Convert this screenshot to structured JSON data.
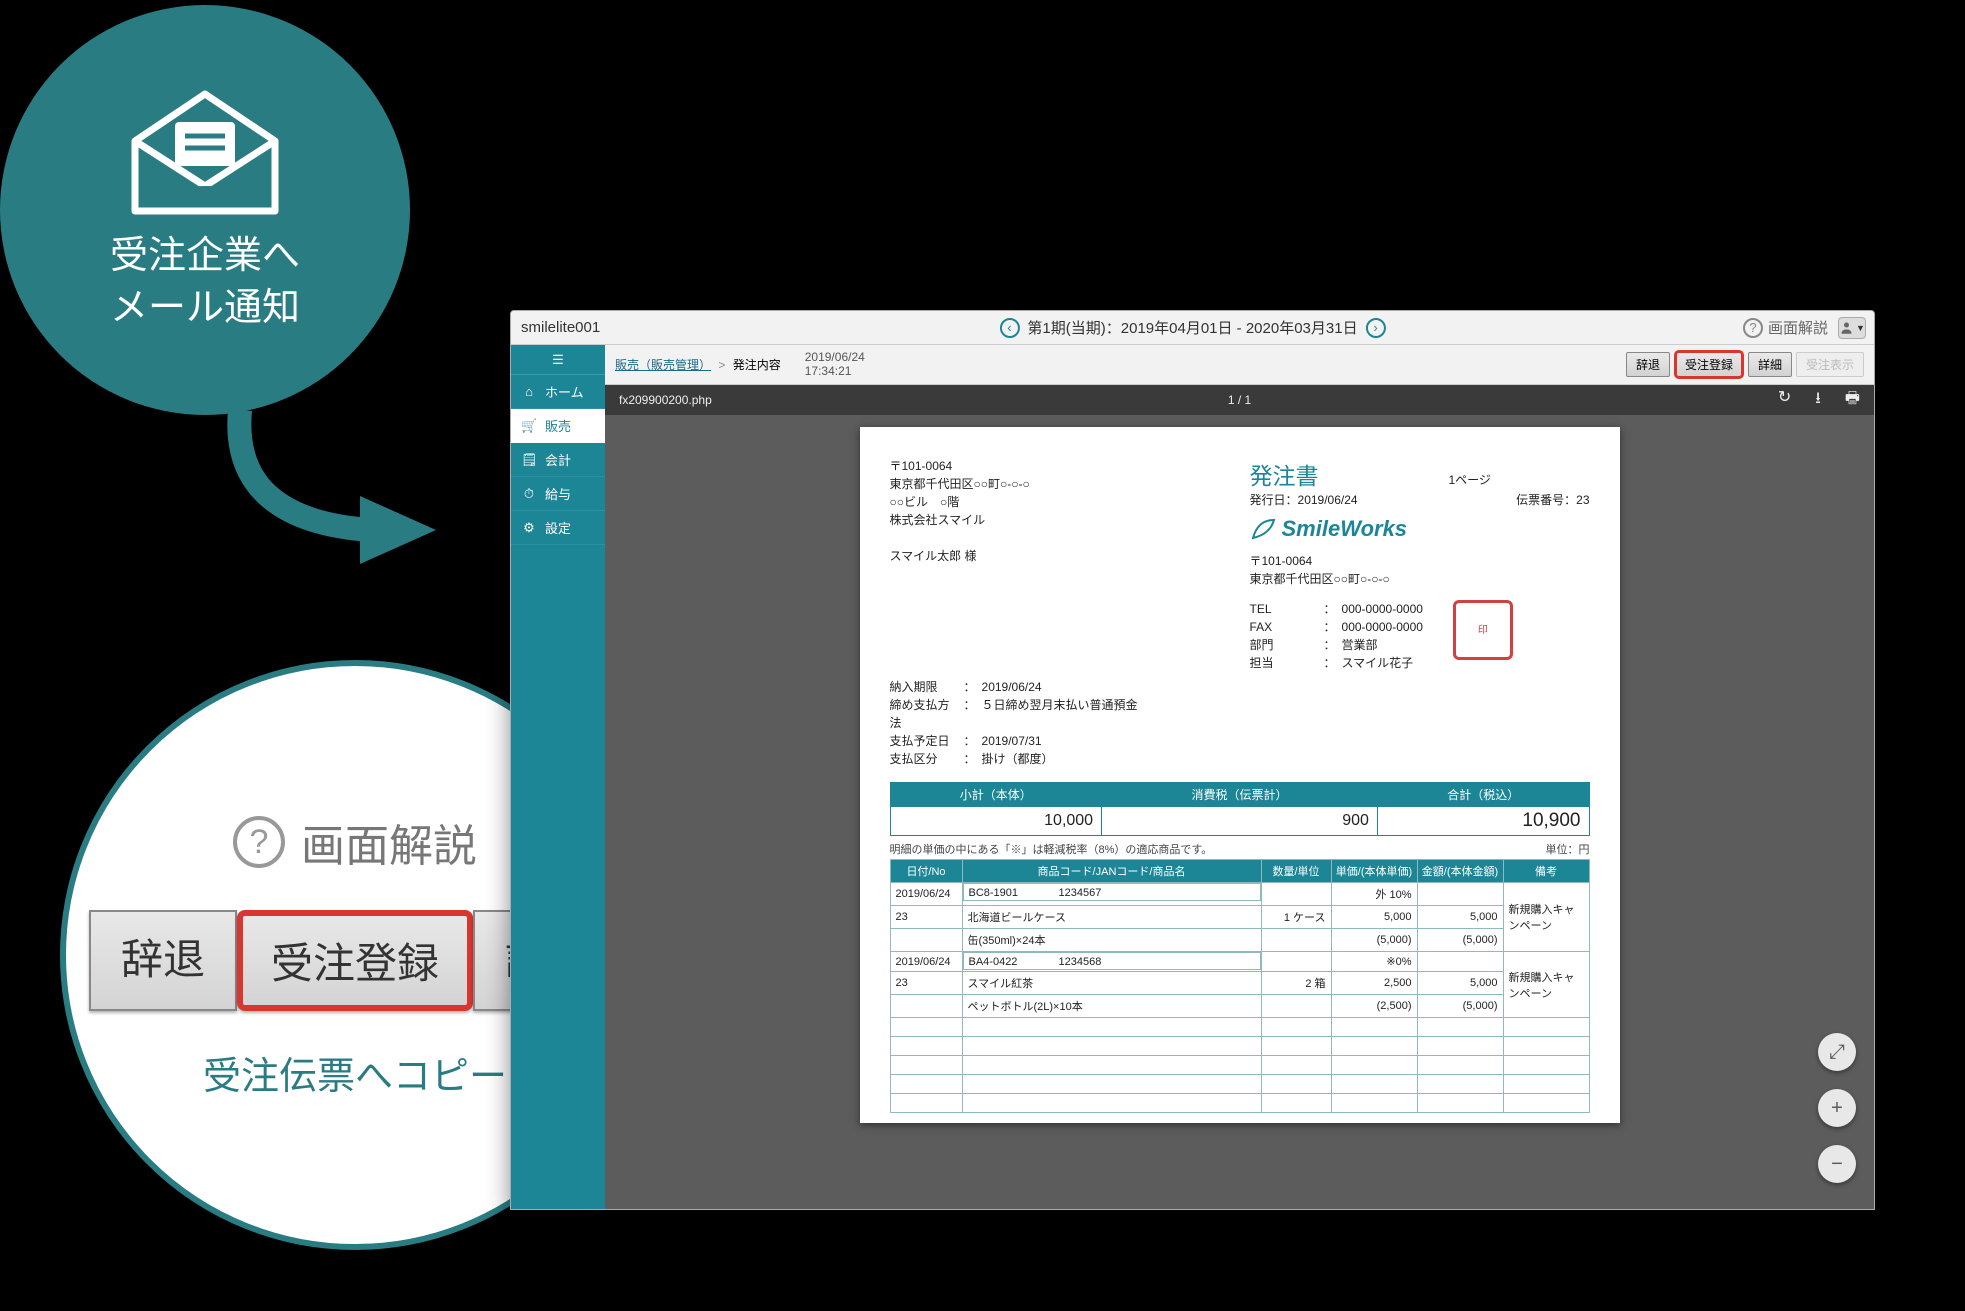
{
  "badge": {
    "line1": "受注企業へ",
    "line2": "メール通知"
  },
  "zoom": {
    "help_label": "画面解説",
    "btn_decline": "辞退",
    "btn_register": "受注登録",
    "btn_detail": "詳細",
    "caption": "受注伝票へコピー"
  },
  "topbar": {
    "title": "smilelite001",
    "period": "第1期(当期)：2019年04月01日 - 2020年03月31日",
    "help_label": "画面解説"
  },
  "sidebar": {
    "items": [
      {
        "icon": "⌂",
        "label": "ホーム"
      },
      {
        "icon": "🛒",
        "label": "販売"
      },
      {
        "icon": "🗒",
        "label": "会計"
      },
      {
        "icon": "⏱",
        "label": "給与"
      },
      {
        "icon": "⚙",
        "label": "設定"
      }
    ]
  },
  "subbar": {
    "crumb_link": "販売（販売管理）",
    "crumb_current": "発注内容",
    "ts_date": "2019/06/24",
    "ts_time": "17:34:21",
    "buttons": {
      "decline": "辞退",
      "register": "受注登録",
      "detail": "詳細",
      "show": "受注表示"
    }
  },
  "viewer": {
    "filename": "fx209900200.php",
    "page": "1 / 1"
  },
  "doc": {
    "sender": {
      "postal": "〒101-0064",
      "addr1": "東京都千代田区○○町○-○-○",
      "addr2": "○○ビル　○階",
      "company": "株式会社スマイル",
      "attn": "スマイル太郎 様"
    },
    "title": "発注書",
    "page_label": "1ページ",
    "issue_label": "発行日：",
    "issue_date": "2019/06/24",
    "slipno_label": "伝票番号：",
    "slipno": "23",
    "brand": "SmileWorks",
    "receiver": {
      "postal": "〒101-0064",
      "addr1": "東京都千代田区○○町○-○-○",
      "tel_label": "TEL",
      "tel": "000-0000-0000",
      "fax_label": "FAX",
      "fax": "000-0000-0000",
      "dept_label": "部門",
      "dept": "営業部",
      "person_label": "担当",
      "person": "スマイル花子"
    },
    "terms": {
      "due_label": "納入期限",
      "due": "2019/06/24",
      "pay_label": "締め支払方法",
      "pay": "５日締め翌月末払い普通預金",
      "sched_label": "支払予定日",
      "sched": "2019/07/31",
      "cat_label": "支払区分",
      "cat": "掛け（都度）"
    },
    "summary": {
      "h1": "小計（本体）",
      "h2": "消費税（伝票計）",
      "h3": "合計（税込）",
      "v1": "10,000",
      "v2": "900",
      "v3": "10,900"
    },
    "note": "明細の単価の中にある「※」は軽減税率（8%）の適応商品です。",
    "unit_note": "単位：円",
    "det_headers": [
      "日付/No",
      "商品コード/JANコード/商品名",
      "数量/単位",
      "単価/(本体単価)",
      "金額/(本体金額)",
      "備考"
    ],
    "details": [
      {
        "date": "2019/06/24",
        "no": "23",
        "code": "BC8-1901",
        "jan": "1234567",
        "name": "北海道ビールケース",
        "sub": "缶(350ml)×24本",
        "qty": "1",
        "unit": "ケース",
        "tax": "外 10%",
        "price": "5,000",
        "price2": "(5,000)",
        "amount": "5,000",
        "amount2": "(5,000)",
        "remark": "新規購入キャンペーン"
      },
      {
        "date": "2019/06/24",
        "no": "23",
        "code": "BA4-0422",
        "jan": "1234568",
        "name": "スマイル紅茶",
        "sub": "ペットボトル(2L)×10本",
        "qty": "2",
        "unit": "箱",
        "tax": "※0%",
        "price": "2,500",
        "price2": "(2,500)",
        "amount": "5,000",
        "amount2": "(5,000)",
        "remark": "新規購入キャンペーン"
      }
    ]
  }
}
